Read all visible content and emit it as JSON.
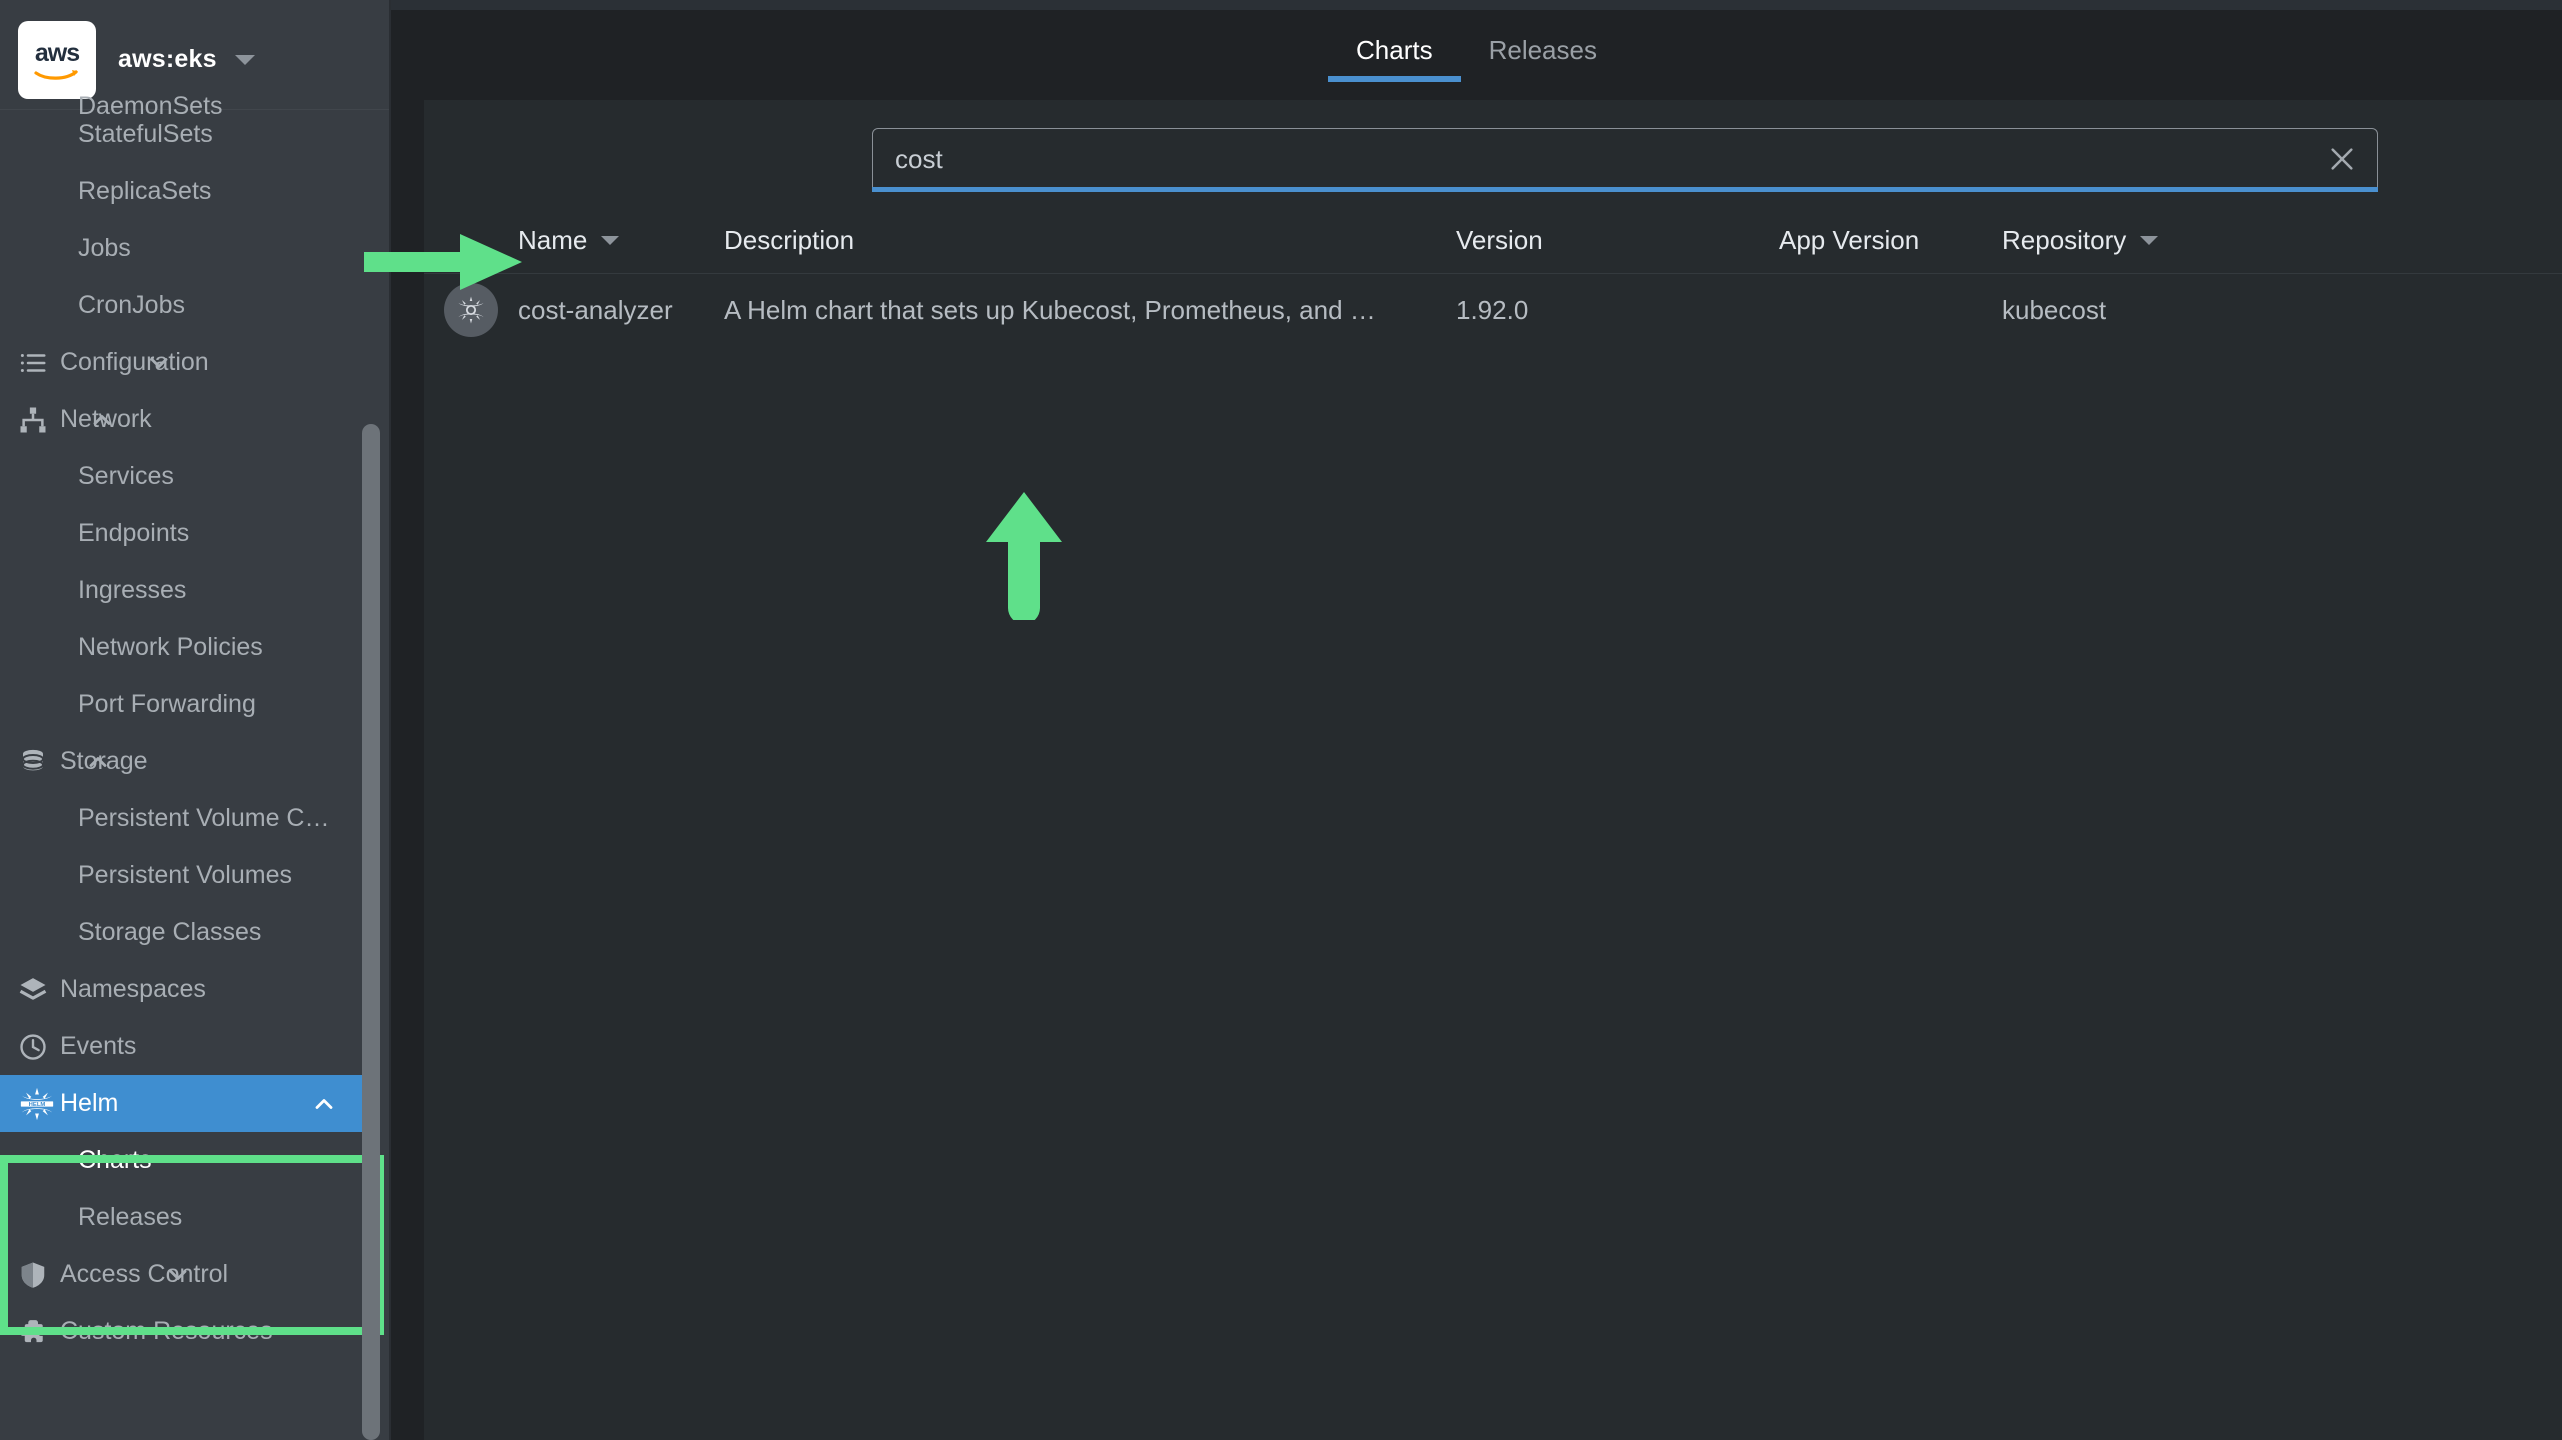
{
  "header": {
    "logo_text": "aws",
    "context_name": "aws:eks",
    "context_caret_icon": "chevron-down-icon"
  },
  "tabs": [
    {
      "label": "Charts",
      "selected": true
    },
    {
      "label": "Releases",
      "selected": false
    }
  ],
  "search": {
    "value": "cost",
    "placeholder": "",
    "clear_icon": "close-icon"
  },
  "table": {
    "columns": [
      {
        "key": "name",
        "label": "Name",
        "sortable": true
      },
      {
        "key": "description",
        "label": "Description",
        "sortable": false
      },
      {
        "key": "version",
        "label": "Version",
        "sortable": false
      },
      {
        "key": "app_version",
        "label": "App Version",
        "sortable": false
      },
      {
        "key": "repository",
        "label": "Repository",
        "sortable": true
      }
    ],
    "rows": [
      {
        "icon": "helm-chart-icon",
        "name": "cost-analyzer",
        "description": "A Helm chart that sets up Kubecost, Prometheus, and …",
        "version": "1.92.0",
        "app_version": "",
        "repository": "kubecost"
      }
    ]
  },
  "sidebar": {
    "items": [
      {
        "label": "DaemonSets",
        "level": "child",
        "icon": "",
        "state": "partial"
      },
      {
        "label": "StatefulSets",
        "level": "child",
        "icon": "",
        "state": "normal"
      },
      {
        "label": "ReplicaSets",
        "level": "child",
        "icon": "",
        "state": "normal"
      },
      {
        "label": "Jobs",
        "level": "child",
        "icon": "",
        "state": "normal"
      },
      {
        "label": "CronJobs",
        "level": "child",
        "icon": "",
        "state": "normal"
      },
      {
        "label": "Configuration",
        "level": "group",
        "icon": "list-icon",
        "state": "collapsed"
      },
      {
        "label": "Network",
        "level": "group",
        "icon": "network-icon",
        "state": "expanded"
      },
      {
        "label": "Services",
        "level": "child",
        "icon": "",
        "state": "normal"
      },
      {
        "label": "Endpoints",
        "level": "child",
        "icon": "",
        "state": "normal"
      },
      {
        "label": "Ingresses",
        "level": "child",
        "icon": "",
        "state": "normal"
      },
      {
        "label": "Network Policies",
        "level": "child",
        "icon": "",
        "state": "normal"
      },
      {
        "label": "Port Forwarding",
        "level": "child",
        "icon": "",
        "state": "normal"
      },
      {
        "label": "Storage",
        "level": "group",
        "icon": "database-icon",
        "state": "expanded"
      },
      {
        "label": "Persistent Volume C…",
        "level": "child",
        "icon": "",
        "state": "normal"
      },
      {
        "label": "Persistent Volumes",
        "level": "child",
        "icon": "",
        "state": "normal"
      },
      {
        "label": "Storage Classes",
        "level": "child",
        "icon": "",
        "state": "normal"
      },
      {
        "label": "Namespaces",
        "level": "group",
        "icon": "layers-icon",
        "state": "plain"
      },
      {
        "label": "Events",
        "level": "group",
        "icon": "clock-icon",
        "state": "plain"
      },
      {
        "label": "Helm",
        "level": "group",
        "icon": "helm-icon",
        "state": "active-expanded"
      },
      {
        "label": "Charts",
        "level": "child",
        "icon": "",
        "state": "selected"
      },
      {
        "label": "Releases",
        "level": "child",
        "icon": "",
        "state": "normal"
      },
      {
        "label": "Access Control",
        "level": "group",
        "icon": "shield-icon",
        "state": "collapsed"
      },
      {
        "label": "Custom Resources",
        "level": "group",
        "icon": "puzzle-icon",
        "state": "partial"
      }
    ]
  },
  "annotations": {
    "highlight_color": "#5fe08a",
    "arrow_right_target": "search-input",
    "arrow_up_target": "chart-name-cell"
  },
  "colors": {
    "page_bg": "#1f2225",
    "sidebar_bg": "#383d43",
    "card_bg": "#262b2e",
    "accent_blue": "#3f8ed0",
    "tab_underline": "#4a90cf",
    "highlight_green": "#5fe08a"
  }
}
